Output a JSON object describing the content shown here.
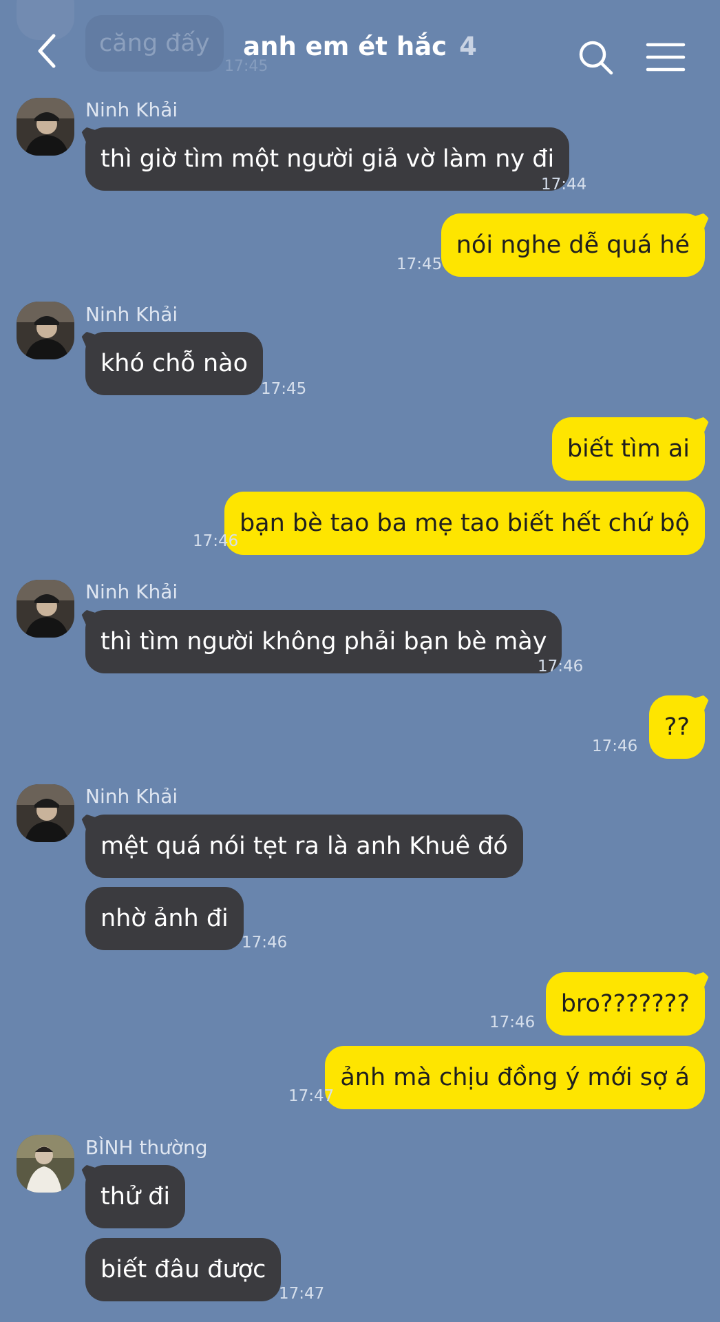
{
  "header": {
    "title": "anh em ét hắc",
    "count": "4"
  },
  "faded": {
    "text": "căng đấy",
    "time": "17:45"
  },
  "messages": [
    {
      "sender": "Ninh Khải",
      "text": "thì giờ tìm một người giả vờ làm ny đi",
      "time": "17:44"
    },
    {
      "text": "nói nghe dễ quá hé",
      "time": "17:45"
    },
    {
      "sender": "Ninh Khải",
      "text": "khó chỗ nào",
      "time": "17:45"
    },
    {
      "text": "biết tìm ai"
    },
    {
      "text": "bạn bè tao ba mẹ tao biết hết chứ bộ",
      "time": "17:46"
    },
    {
      "sender": "Ninh Khải",
      "text": "thì tìm người không phải bạn bè mày",
      "time": "17:46"
    },
    {
      "text": "??",
      "time": "17:46"
    },
    {
      "sender": "Ninh Khải",
      "text": "mệt quá nói tẹt ra là anh Khuê đó"
    },
    {
      "text": "nhờ ảnh đi",
      "time": "17:46"
    },
    {
      "text": "bro???????",
      "time": "17:46"
    },
    {
      "text": "ảnh mà chịu đồng ý mới sợ á",
      "time": "17:47"
    },
    {
      "sender": "BÌNH thường",
      "text": "thử đi"
    },
    {
      "text": "biết đâu được",
      "time": "17:47"
    }
  ],
  "colors": {
    "background": "#6985ad",
    "incoming_bubble": "#3b3b3f",
    "outgoing_bubble": "#fee500"
  },
  "icons": [
    "back-arrow-icon",
    "search-icon",
    "hamburger-menu-icon",
    "avatar-ninh-khai",
    "avatar-binh-thuong"
  ]
}
